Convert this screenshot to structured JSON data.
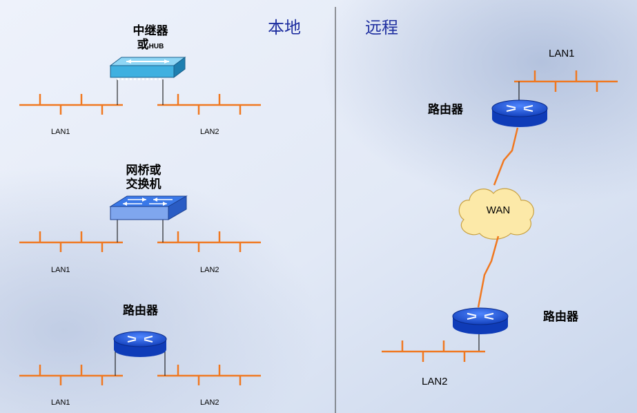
{
  "headings": {
    "local": "本地",
    "remote": "远程"
  },
  "local": {
    "hub": {
      "label_line1": "中继器",
      "label_line2_prefix": "或",
      "label_line2_suffix": "HUB",
      "lan_left": "LAN1",
      "lan_right": "LAN2"
    },
    "bridge": {
      "label_line1": "网桥或",
      "label_line2": "交换机",
      "lan_left": "LAN1",
      "lan_right": "LAN2"
    },
    "router": {
      "label": "路由器",
      "lan_left": "LAN1",
      "lan_right": "LAN2"
    }
  },
  "remote": {
    "lan_top": "LAN1",
    "router_top": "路由器",
    "wan": "WAN",
    "router_bottom": "路由器",
    "lan_bottom": "LAN2"
  },
  "colors": {
    "lan_line": "#f07820",
    "wan_link": "#f07820",
    "title_text": "#1f2fa0",
    "router_blue": "#1c4fd8",
    "hub_cyan": "#3fb0e0",
    "switch_blue": "#3a78e8",
    "cloud_fill": "#fce9a8"
  }
}
